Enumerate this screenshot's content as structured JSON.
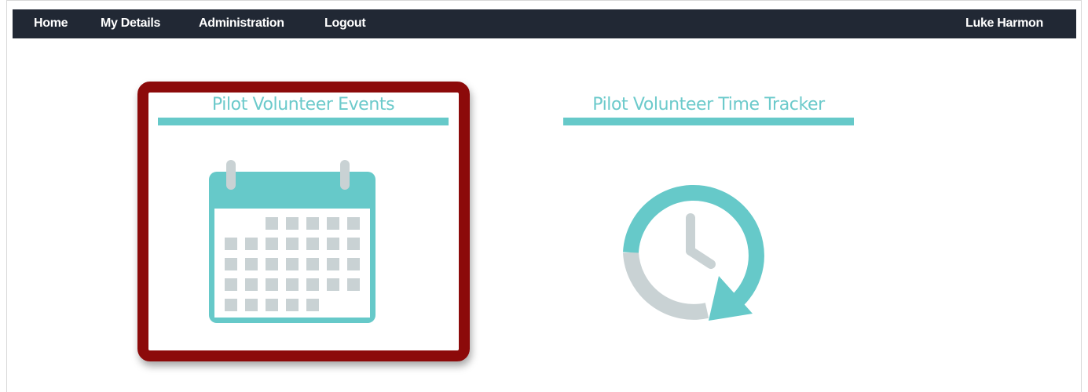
{
  "nav": {
    "home": "Home",
    "my_details": "My Details",
    "administration": "Administration",
    "logout": "Logout",
    "user": "Luke Harmon"
  },
  "tiles": [
    {
      "title": "Pilot Volunteer Events",
      "icon": "calendar-icon"
    },
    {
      "title": "Pilot Volunteer Time Tracker",
      "icon": "clock-icon"
    }
  ],
  "colors": {
    "navbar": "#212834",
    "accent": "#66c9c9",
    "highlight": "#8c0a0a",
    "icon_gray": "#c9d2d4"
  }
}
